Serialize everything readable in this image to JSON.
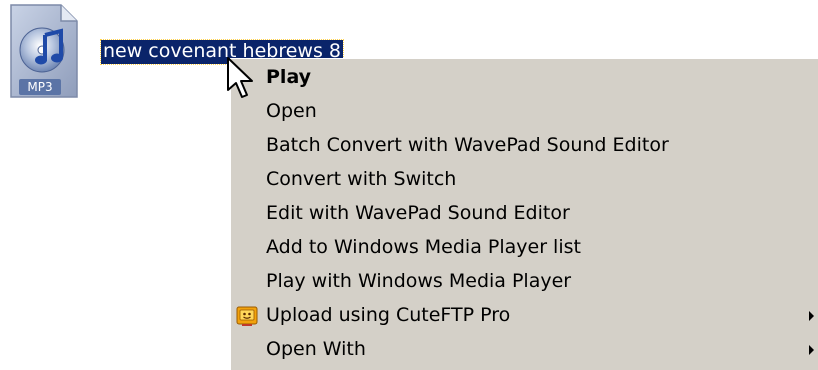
{
  "file": {
    "icon": "mp3-audio-file-icon",
    "type_badge": "MP3",
    "name": "new covenant hebrews 8"
  },
  "context_menu": {
    "items": [
      {
        "label": "Play",
        "default": true,
        "has_submenu": false,
        "icon": null
      },
      {
        "label": "Open",
        "default": false,
        "has_submenu": false,
        "icon": null
      },
      {
        "label": "Batch Convert with WavePad Sound Editor",
        "default": false,
        "has_submenu": false,
        "icon": null
      },
      {
        "label": "Convert with Switch",
        "default": false,
        "has_submenu": false,
        "icon": null
      },
      {
        "label": "Edit with WavePad Sound Editor",
        "default": false,
        "has_submenu": false,
        "icon": null
      },
      {
        "label": "Add to Windows Media Player list",
        "default": false,
        "has_submenu": false,
        "icon": null
      },
      {
        "label": "Play with Windows Media Player",
        "default": false,
        "has_submenu": false,
        "icon": null
      },
      {
        "label": "Upload using CuteFTP Pro",
        "default": false,
        "has_submenu": true,
        "icon": "cuteftp-icon"
      },
      {
        "label": "Open With",
        "default": false,
        "has_submenu": true,
        "icon": null
      }
    ]
  },
  "colors": {
    "selection_bg": "#0a246a",
    "menu_bg": "#d4d0c8",
    "desktop_bg": "#ffffff"
  }
}
